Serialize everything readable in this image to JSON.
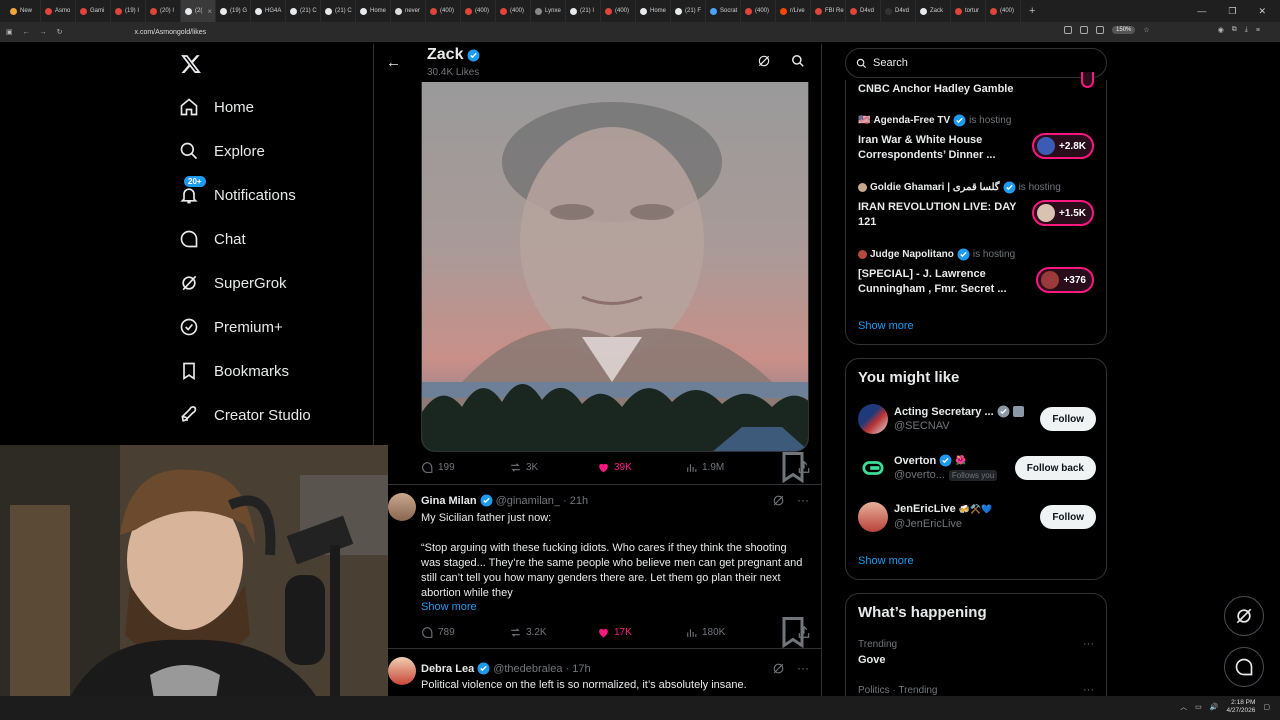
{
  "browser": {
    "tabs": [
      {
        "label": "New",
        "color": "#f3a63c"
      },
      {
        "label": "Asmo",
        "color": "#e0453b"
      },
      {
        "label": "Gami",
        "color": "#e0453b"
      },
      {
        "label": "(19) I",
        "color": "#e0453b"
      },
      {
        "label": "(20) I",
        "color": "#e0453b"
      },
      {
        "label": "(2(",
        "color": "#e7e9ea",
        "active": true
      },
      {
        "label": "(19) G",
        "color": "#e7e9ea"
      },
      {
        "label": "HG4A",
        "color": "#e7e9ea"
      },
      {
        "label": "(21) C",
        "color": "#e7e9ea"
      },
      {
        "label": "(21) C",
        "color": "#e7e9ea"
      },
      {
        "label": "Home",
        "color": "#e7e9ea"
      },
      {
        "label": "never",
        "color": "#ddd"
      },
      {
        "label": "(400)",
        "color": "#e0453b"
      },
      {
        "label": "(400)",
        "color": "#e0453b"
      },
      {
        "label": "(400)",
        "color": "#e0453b"
      },
      {
        "label": "Lynxe",
        "color": "#888"
      },
      {
        "label": "(21) I",
        "color": "#e7e9ea"
      },
      {
        "label": "(400)",
        "color": "#e0453b"
      },
      {
        "label": "Home",
        "color": "#e7e9ea"
      },
      {
        "label": "(21) F",
        "color": "#e7e9ea"
      },
      {
        "label": "Socrat",
        "color": "#4aa3ff"
      },
      {
        "label": "(400)",
        "color": "#e0453b"
      },
      {
        "label": "r/Live",
        "color": "#ff4500"
      },
      {
        "label": "FBI Re",
        "color": "#e0453b"
      },
      {
        "label": "D4vd",
        "color": "#e0453b"
      },
      {
        "label": "D4vd",
        "color": "#333"
      },
      {
        "label": "Zack",
        "color": "#e7e9ea"
      },
      {
        "label": "tortur",
        "color": "#e0453b"
      },
      {
        "label": "(400)",
        "color": "#e0453b"
      }
    ],
    "url": "x.com/Asmongold/likes",
    "zoom": "150%"
  },
  "nav": {
    "items": [
      {
        "label": "Home",
        "icon": "home-icon"
      },
      {
        "label": "Explore",
        "icon": "search-icon"
      },
      {
        "label": "Notifications",
        "icon": "bell-icon",
        "badge": "20+"
      },
      {
        "label": "Chat",
        "icon": "chat-icon"
      },
      {
        "label": "SuperGrok",
        "icon": "grok-icon"
      },
      {
        "label": "Premium+",
        "icon": "premium-icon"
      },
      {
        "label": "Bookmarks",
        "icon": "bookmark-icon"
      },
      {
        "label": "Creator Studio",
        "icon": "rocket-icon"
      }
    ]
  },
  "profile": {
    "name": "Zack",
    "likes_count": "30.4K Likes"
  },
  "tweets": [
    {
      "replies": "199",
      "reposts": "3K",
      "likes": "39K",
      "views": "1.9M"
    },
    {
      "name": "Gina Milan",
      "handle": "@ginamilan_",
      "time": "· 21h",
      "line1": "My Sicilian father just now:",
      "line2": "“Stop arguing with these fucking idiots. Who cares if they think the shooting was staged... They’re the same people who believe men can get pregnant and still can’t tell you how many genders there are. Let them go plan their next abortion while they",
      "show_more": "Show more",
      "replies": "789",
      "reposts": "3.2K",
      "likes": "17K",
      "views": "180K"
    },
    {
      "name": "Debra Lea",
      "handle": "@thedebralea",
      "time": "· 17h",
      "line1": "Political violence on the left is so normalized, it’s absolutely insane."
    }
  ],
  "right": {
    "search_placeholder": "Search",
    "spaces": [
      {
        "title": "CNBC Anchor Hadley Gamble"
      },
      {
        "host": "Agenda-Free TV",
        "status": "is hosting",
        "title": "Iran War & White House Correspondents’ Dinner ...",
        "count": "+2.8K"
      },
      {
        "host": "Goldie Ghamari | گلسا قمری",
        "status": "is hosting",
        "title": "IRAN REVOLUTION LIVE: DAY 121",
        "count": "+1.5K"
      },
      {
        "host": "Judge Napolitano",
        "status": "is hosting",
        "title": "[SPECIAL] - J. Lawrence Cunningham , Fmr. Secret ...",
        "count": "+376"
      }
    ],
    "spaces_show_more": "Show more",
    "you_might_like": {
      "title": "You might like",
      "people": [
        {
          "name": "Acting Secretary ...",
          "handle": "@SECNAV",
          "button": "Follow"
        },
        {
          "name": "Overton",
          "handle": "@overto...",
          "follows_you": "Follows you",
          "button": "Follow back"
        },
        {
          "name": "JenEricLive",
          "handle": "@JenEricLive",
          "button": "Follow"
        }
      ],
      "show_more": "Show more"
    },
    "whats_happening": {
      "title": "What’s happening",
      "trends": [
        {
          "context": "Trending",
          "name": "Gove"
        },
        {
          "context": "Politics · Trending",
          "name": ""
        }
      ]
    }
  },
  "taskbar": {
    "time": "2:18 PM",
    "date": "4/27/2026"
  },
  "colors": {
    "accent": "#1d9bf0",
    "like": "#f91880",
    "border": "#2f3336",
    "muted": "#71767b"
  }
}
